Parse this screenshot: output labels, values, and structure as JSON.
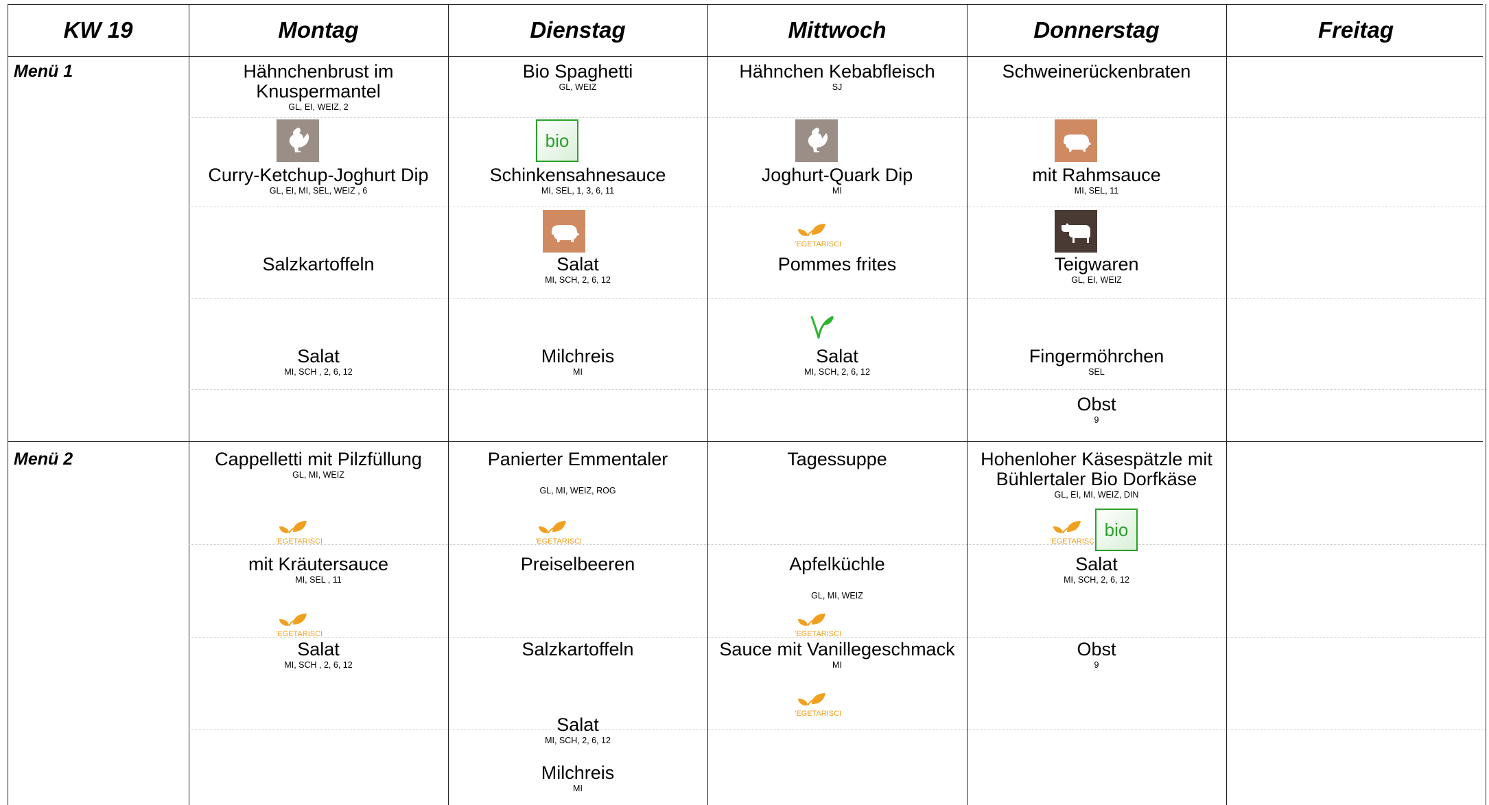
{
  "header": {
    "week": "KW 19",
    "days": [
      "Montag",
      "Dienstag",
      "Mittwoch",
      "Donnerstag",
      "Freitag"
    ]
  },
  "menus": [
    {
      "label": "Menü 1",
      "days": [
        [
          {
            "name": "Hähnchenbrust im Knuspermantel",
            "allergens": "GL, EI, WEIZ, 2"
          },
          {
            "name": "Curry-Ketchup-Joghurt Dip",
            "allergens": "GL, EI, MI, SEL, WEIZ , 6"
          },
          {
            "name": "Salzkartoffeln",
            "allergens": ""
          },
          {
            "name": "Salat",
            "allergens": "MI, SCH , 2, 6, 12"
          }
        ],
        [
          {
            "name": "Bio Spaghetti",
            "allergens": "GL, WEIZ"
          },
          {
            "name": "Schinkensahnesauce",
            "allergens": "MI, SEL, 1, 3, 6, 11"
          },
          {
            "name": "Salat",
            "allergens": "MI, SCH, 2, 6, 12"
          },
          {
            "name": "Milchreis",
            "allergens": "MI"
          }
        ],
        [
          {
            "name": "Hähnchen Kebabfleisch",
            "allergens": "SJ"
          },
          {
            "name": "Joghurt-Quark Dip",
            "allergens": "MI"
          },
          {
            "name": "Pommes frites",
            "allergens": ""
          },
          {
            "name": "Salat",
            "allergens": "MI, SCH, 2, 6, 12"
          }
        ],
        [
          {
            "name": "Schweinerückenbraten",
            "allergens": ""
          },
          {
            "name": "mit Rahmsauce",
            "allergens": "MI, SEL, 11"
          },
          {
            "name": "Teigwaren",
            "allergens": "GL, EI, WEIZ"
          },
          {
            "name": "Fingermöhrchen",
            "allergens": "SEL"
          },
          {
            "name": "Obst",
            "allergens": "9"
          }
        ],
        []
      ]
    },
    {
      "label": "Menü 2",
      "days": [
        [
          {
            "name": "Cappelletti mit Pilzfüllung",
            "allergens": "GL, MI, WEIZ"
          },
          {
            "name": "mit Kräutersauce",
            "allergens": "MI, SEL , 11"
          },
          {
            "name": "Salat",
            "allergens": "MI, SCH , 2, 6, 12"
          }
        ],
        [
          {
            "name": "Panierter Emmentaler",
            "allergens": "GL, MI, WEIZ, ROG"
          },
          {
            "name": "Preiselbeeren",
            "allergens": ""
          },
          {
            "name": "Salzkartoffeln",
            "allergens": ""
          },
          {
            "name": "Salat",
            "allergens": "MI, SCH, 2, 6, 12"
          },
          {
            "name": "Milchreis",
            "allergens": "MI"
          }
        ],
        [
          {
            "name": "Tagessuppe",
            "allergens": ""
          },
          {
            "name": "Apfelküchle",
            "allergens": "GL, MI, WEIZ"
          },
          {
            "name": "Sauce mit Vanillegeschmack",
            "allergens": "MI"
          }
        ],
        [
          {
            "name": "Hohenloher Käsespätzle mit Bühlertaler Bio Dorfkäse",
            "allergens": "GL, EI, MI, WEIZ, DIN"
          },
          {
            "name": "Salat",
            "allergens": "MI, SCH, 2, 6, 12"
          },
          {
            "name": "Obst",
            "allergens": "9"
          }
        ],
        []
      ]
    }
  ],
  "icons": {
    "chicken": "chicken-icon",
    "pig": "pig-icon",
    "cow": "cow-icon",
    "bio": "bio-icon",
    "vegetarian": "vegetarian-icon",
    "vegan": "vegan-icon",
    "vegetarian_label": "VEGETARISCH",
    "bio_label": "bio"
  },
  "colors": {
    "chicken_bg": "#9a8e86",
    "pig_bg": "#d08a62",
    "cow_bg": "#4a3a34",
    "bio_green": "#2aa02a",
    "vegetarian_orange": "#f0a020",
    "vegan_green": "#2db52d"
  }
}
